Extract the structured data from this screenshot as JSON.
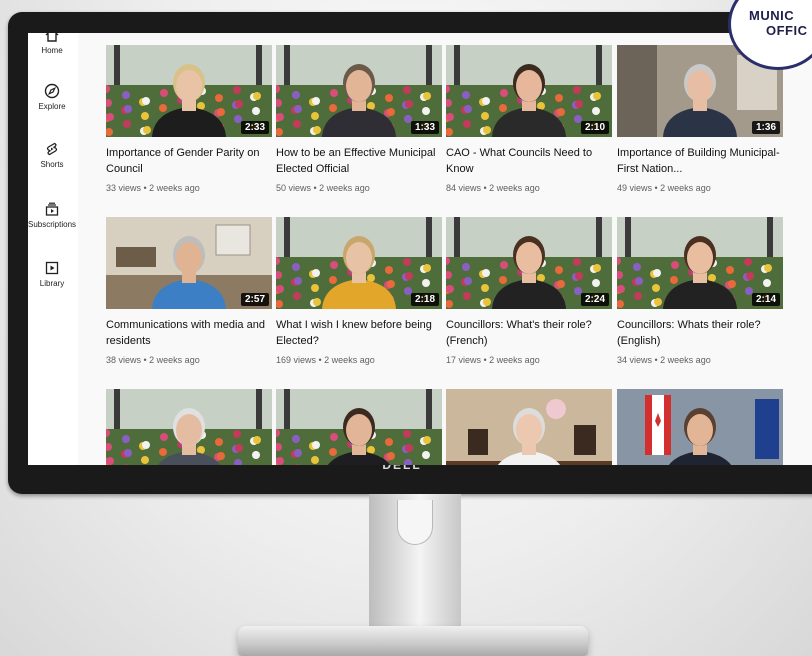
{
  "badge": {
    "line1": "MUNIC",
    "line2": "OFFIC"
  },
  "monitor": {
    "brand": "DELL"
  },
  "sidebar": {
    "items": [
      {
        "label": "Home",
        "icon": "home-icon"
      },
      {
        "label": "Explore",
        "icon": "compass-icon"
      },
      {
        "label": "Shorts",
        "icon": "shorts-icon"
      },
      {
        "label": "Subscriptions",
        "icon": "subscriptions-icon"
      },
      {
        "label": "Library",
        "icon": "library-icon"
      }
    ]
  },
  "videos": [
    {
      "title": "Importance of Gender Parity on Council",
      "duration": "2:33",
      "views": "33 views",
      "age": "2 weeks ago",
      "meta": "33 views • 2 weeks ago",
      "scene": "flowers",
      "person": {
        "skin": "#e9c3a6",
        "hair": "#d9c18a",
        "shirt": "#1d1d1d"
      }
    },
    {
      "title": "How to be an Effective Municipal Elected Official",
      "duration": "1:33",
      "views": "50 views",
      "age": "2 weeks ago",
      "meta": "50 views • 2 weeks ago",
      "scene": "flowers",
      "person": {
        "skin": "#e2b596",
        "hair": "#6b5a48",
        "shirt": "#2e2e34"
      }
    },
    {
      "title": "CAO - What Councils Need to Know",
      "duration": "2:10",
      "views": "84 views",
      "age": "2 weeks ago",
      "meta": "84 views • 2 weeks ago",
      "scene": "flowers",
      "person": {
        "skin": "#e6b79a",
        "hair": "#3a2a20",
        "shirt": "#2a2a2a"
      }
    },
    {
      "title": "Importance of Building Municipal-First Nation...",
      "duration": "1:36",
      "views": "49 views",
      "age": "2 weeks ago",
      "meta": "49 views • 2 weeks ago",
      "scene": "office",
      "person": {
        "skin": "#e7bda3",
        "hair": "#c9c9c9",
        "shirt": "#2b3447"
      }
    },
    {
      "title": "Communications with media and residents",
      "duration": "2:57",
      "views": "38 views",
      "age": "2 weeks ago",
      "meta": "38 views • 2 weeks ago",
      "scene": "room",
      "person": {
        "skin": "#e0b392",
        "hair": "#bdbdbd",
        "shirt": "#3d7fc4"
      }
    },
    {
      "title": "What I wish I knew before being Elected?",
      "duration": "2:18",
      "views": "169 views",
      "age": "2 weeks ago",
      "meta": "169 views • 2 weeks ago",
      "scene": "flowers",
      "person": {
        "skin": "#e8c2a5",
        "hair": "#c8a66c",
        "shirt": "#e2a72a"
      }
    },
    {
      "title": "Councillors: What's their role? (French)",
      "duration": "2:24",
      "views": "17 views",
      "age": "2 weeks ago",
      "meta": "17 views • 2 weeks ago",
      "scene": "flowers",
      "person": {
        "skin": "#e9bea0",
        "hair": "#4a3020",
        "shirt": "#222222"
      }
    },
    {
      "title": "Councillors: Whats their role? (English)",
      "duration": "2:14",
      "views": "34 views",
      "age": "2 weeks ago",
      "meta": "34 views • 2 weeks ago",
      "scene": "flowers",
      "person": {
        "skin": "#e9bea0",
        "hair": "#4a3020",
        "shirt": "#222222"
      }
    },
    {
      "title": "",
      "duration": "",
      "views": "",
      "age": "",
      "meta": "",
      "scene": "flowers",
      "person": {
        "skin": "#e4bca2",
        "hair": "#e0e0e0",
        "shirt": "#4a4f5c"
      }
    },
    {
      "title": "",
      "duration": "",
      "views": "",
      "age": "",
      "meta": "",
      "scene": "flowers",
      "person": {
        "skin": "#e2b596",
        "hair": "#3a2a20",
        "shirt": "#1d1d22"
      }
    },
    {
      "title": "",
      "duration": "",
      "views": "",
      "age": "",
      "meta": "",
      "scene": "desk",
      "person": {
        "skin": "#ecc8b0",
        "hair": "#dcdcdc",
        "shirt": "#f2f2f2"
      }
    },
    {
      "title": "",
      "duration": "",
      "views": "",
      "age": "",
      "meta": "",
      "scene": "flags",
      "person": {
        "skin": "#e2b596",
        "hair": "#5a4030",
        "shirt": "#1f2433"
      }
    }
  ]
}
